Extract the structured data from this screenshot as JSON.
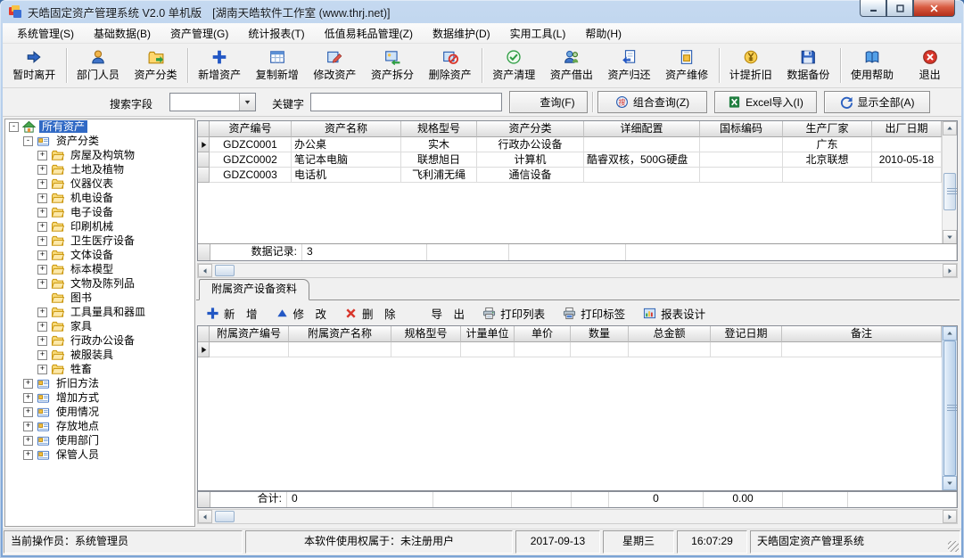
{
  "window": {
    "title": "天皓固定资产管理系统 V2.0 单机版",
    "subtitle": "[湖南天皓软件工作室 (www.thrj.net)]",
    "app_icon": "app-icon",
    "controls": [
      {
        "name": "minimize-button",
        "icon": "minimize-icon"
      },
      {
        "name": "maximize-button",
        "icon": "maximize-icon"
      },
      {
        "name": "close-button",
        "icon": "close-icon"
      }
    ]
  },
  "menu": {
    "items": [
      "系统管理(S)",
      "基础数据(B)",
      "资产管理(G)",
      "统计报表(T)",
      "低值易耗品管理(Z)",
      "数据维护(D)",
      "实用工具(L)",
      "帮助(H)"
    ]
  },
  "toolbar": {
    "groups": [
      [
        {
          "label": "暂时离开",
          "icon": "leave-icon"
        }
      ],
      [
        {
          "label": "部门人员",
          "icon": "people-icon"
        },
        {
          "label": "资产分类",
          "icon": "category-icon"
        }
      ],
      [
        {
          "label": "新增资产",
          "icon": "add-icon"
        },
        {
          "label": "复制新增",
          "icon": "copy-add-icon"
        },
        {
          "label": "修改资产",
          "icon": "edit-icon"
        },
        {
          "label": "资产拆分",
          "icon": "split-icon"
        },
        {
          "label": "删除资产",
          "icon": "delete-icon"
        }
      ],
      [
        {
          "label": "资产清理",
          "icon": "clean-icon"
        },
        {
          "label": "资产借出",
          "icon": "lend-icon"
        },
        {
          "label": "资产归还",
          "icon": "return-icon"
        },
        {
          "label": "资产维修",
          "icon": "repair-icon"
        }
      ],
      [
        {
          "label": "计提折旧",
          "icon": "depreciation-icon"
        },
        {
          "label": "数据备份",
          "icon": "backup-icon"
        }
      ],
      [
        {
          "label": "使用帮助",
          "icon": "help-icon"
        },
        {
          "label": "退出",
          "icon": "exit-icon"
        }
      ]
    ]
  },
  "search": {
    "field_label": "搜索字段",
    "field_value": "",
    "keyword_label": "关键字",
    "keyword_value": "",
    "query_button": {
      "label": "查询(F)",
      "icon": "query-icon"
    },
    "combo_button": {
      "label": "组合查询(Z)",
      "icon": "combo-query-icon"
    },
    "excel_button": {
      "label": "Excel导入(I)",
      "icon": "excel-icon"
    },
    "showall_button": {
      "label": "显示全部(A)",
      "icon": "show-all-icon"
    }
  },
  "tree": {
    "items": [
      {
        "label": "所有资产",
        "level": 0,
        "icon": "home-icon",
        "expand": "-",
        "selected": true
      },
      {
        "label": "资产分类",
        "level": 1,
        "icon": "card-icon",
        "expand": "-"
      },
      {
        "label": "房屋及构筑物",
        "level": 2,
        "icon": "folder-icon",
        "expand": "+"
      },
      {
        "label": "土地及植物",
        "level": 2,
        "icon": "folder-icon",
        "expand": "+"
      },
      {
        "label": "仪器仪表",
        "level": 2,
        "icon": "folder-icon",
        "expand": "+"
      },
      {
        "label": "机电设备",
        "level": 2,
        "icon": "folder-icon",
        "expand": "+"
      },
      {
        "label": "电子设备",
        "level": 2,
        "icon": "folder-icon",
        "expand": "+"
      },
      {
        "label": "印刷机械",
        "level": 2,
        "icon": "folder-icon",
        "expand": "+"
      },
      {
        "label": "卫生医疗设备",
        "level": 2,
        "icon": "folder-icon",
        "expand": "+"
      },
      {
        "label": "文体设备",
        "level": 2,
        "icon": "folder-icon",
        "expand": "+"
      },
      {
        "label": "标本模型",
        "level": 2,
        "icon": "folder-icon",
        "expand": "+"
      },
      {
        "label": "文物及陈列品",
        "level": 2,
        "icon": "folder-icon",
        "expand": "+"
      },
      {
        "label": "图书",
        "level": 2,
        "icon": "folder-icon",
        "expand": ""
      },
      {
        "label": "工具量具和器皿",
        "level": 2,
        "icon": "folder-icon",
        "expand": "+"
      },
      {
        "label": "家具",
        "level": 2,
        "icon": "folder-icon",
        "expand": "+"
      },
      {
        "label": "行政办公设备",
        "level": 2,
        "icon": "folder-icon",
        "expand": "+"
      },
      {
        "label": "被服装具",
        "level": 2,
        "icon": "folder-icon",
        "expand": "+"
      },
      {
        "label": "牲畜",
        "level": 2,
        "icon": "folder-icon",
        "expand": "+"
      },
      {
        "label": "折旧方法",
        "level": 1,
        "icon": "card-icon",
        "expand": "+"
      },
      {
        "label": "增加方式",
        "level": 1,
        "icon": "card-icon",
        "expand": "+"
      },
      {
        "label": "使用情况",
        "level": 1,
        "icon": "card-icon",
        "expand": "+"
      },
      {
        "label": "存放地点",
        "level": 1,
        "icon": "card-icon",
        "expand": "+"
      },
      {
        "label": "使用部门",
        "level": 1,
        "icon": "card-icon",
        "expand": "+"
      },
      {
        "label": "保管人员",
        "level": 1,
        "icon": "card-icon",
        "expand": "+"
      }
    ]
  },
  "main_grid": {
    "columns": [
      "资产编号",
      "资产名称",
      "规格型号",
      "资产分类",
      "详细配置",
      "国标编码",
      "生产厂家",
      "出厂日期"
    ],
    "rows": [
      [
        "GDZC0001",
        "办公桌",
        "实木",
        "行政办公设备",
        "",
        "",
        "广东",
        ""
      ],
      [
        "GDZC0002",
        "笔记本电脑",
        "联想旭日",
        "计算机",
        "酷睿双核，500G硬盘",
        "",
        "北京联想",
        "2010-05-18"
      ],
      [
        "GDZC0003",
        "电话机",
        "飞利浦无绳",
        "通信设备",
        "",
        "",
        "",
        ""
      ]
    ],
    "active_row": 0,
    "footer_cells": [
      "数据记录:",
      "3",
      "",
      "",
      ""
    ]
  },
  "sub_panel": {
    "tab_label": "附属资产设备资料",
    "toolbar": [
      {
        "label": "新　增",
        "icon": "plus-icon"
      },
      {
        "label": "修　改",
        "icon": "triangle-icon"
      },
      {
        "label": "删　除",
        "icon": "x-icon"
      },
      {
        "label": "导　出",
        "icon": "export-icon"
      },
      {
        "label": "打印列表",
        "icon": "print-icon"
      },
      {
        "label": "打印标签",
        "icon": "print-label-icon"
      },
      {
        "label": "报表设计",
        "icon": "report-design-icon"
      }
    ],
    "grid": {
      "columns": [
        "附属资产编号",
        "附属资产名称",
        "规格型号",
        "计量单位",
        "单价",
        "数量",
        "总金额",
        "登记日期",
        "备注"
      ],
      "rows": [
        [
          "",
          "",
          "",
          "",
          "",
          "",
          "",
          "",
          ""
        ]
      ],
      "active_row": 0
    },
    "footer_cells": [
      "合计:",
      "0",
      "",
      "",
      "",
      "0",
      "0.00",
      "",
      ""
    ]
  },
  "status_bar": {
    "sections": [
      "当前操作员：系统管理员",
      "本软件使用权属于：未注册用户",
      "2017-09-13",
      "星期三",
      "16:07:29",
      "天皓固定资产管理系统"
    ]
  },
  "colors": {
    "selection_blue": "#316ac5",
    "titlebar_blue": "#8fb3de",
    "close_red": "#c2361f",
    "accent_blue": "#2257c4",
    "excel_green": "#1f7e3f",
    "delete_red": "#d8352a"
  }
}
